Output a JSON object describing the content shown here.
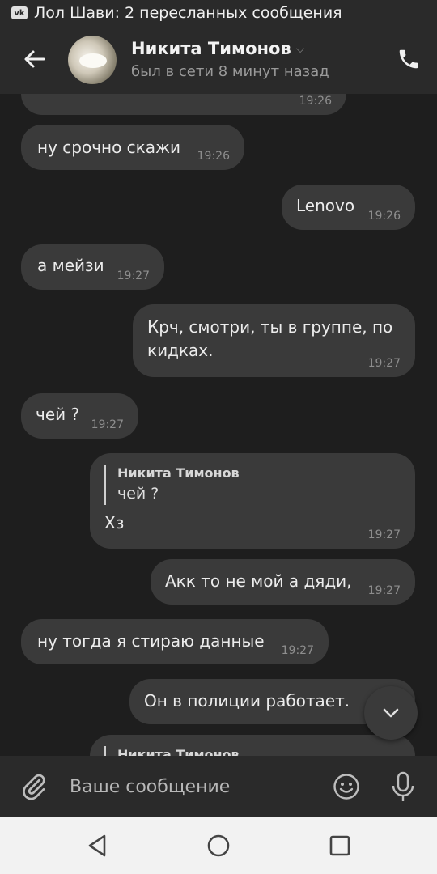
{
  "notification": {
    "text": "Лол Шави: 2 пересланных сообщения"
  },
  "header": {
    "name": "Никита Тимонов",
    "status": "был в сети 8 минут назад"
  },
  "messages": [
    {
      "id": "partial",
      "out": false,
      "text": "",
      "time": "19:26"
    },
    {
      "id": "m1",
      "out": false,
      "text": "ну срочно скажи",
      "time": "19:26"
    },
    {
      "id": "m2",
      "out": true,
      "text": "Lenovo",
      "time": "19:26"
    },
    {
      "id": "m3",
      "out": false,
      "text": "а мейзи",
      "time": "19:27"
    },
    {
      "id": "m4",
      "out": true,
      "text": "Крч, смотри, ты в группе, по кидках.",
      "time": "19:27"
    },
    {
      "id": "m5",
      "out": false,
      "text": "чей ?",
      "time": "19:27"
    },
    {
      "id": "m6",
      "out": true,
      "reply_name": "Никита Тимонов",
      "reply_text": "чей ?",
      "text": "Хз",
      "time": "19:27"
    },
    {
      "id": "m7",
      "out": true,
      "text": "Акк то не мой а дяди,",
      "time": "19:27"
    },
    {
      "id": "m8",
      "out": false,
      "text": "ну тогда я стираю данные",
      "time": "19:27"
    },
    {
      "id": "m9",
      "out": true,
      "text": "Он в полиции работает.",
      "time": ""
    },
    {
      "id": "m10",
      "out": true,
      "reply_name": "Никита Тимонов",
      "text": "",
      "time": ""
    }
  ],
  "input": {
    "placeholder": "Ваше сообщение"
  },
  "icons": {
    "back": "arrow-left-icon",
    "phone": "phone-icon",
    "attach": "paperclip-icon",
    "emoji": "smile-icon",
    "mic": "microphone-icon",
    "scroll_down": "chevron-down-icon",
    "nav_back": "triangle-back-icon",
    "nav_home": "circle-home-icon",
    "nav_recent": "square-recent-icon"
  }
}
